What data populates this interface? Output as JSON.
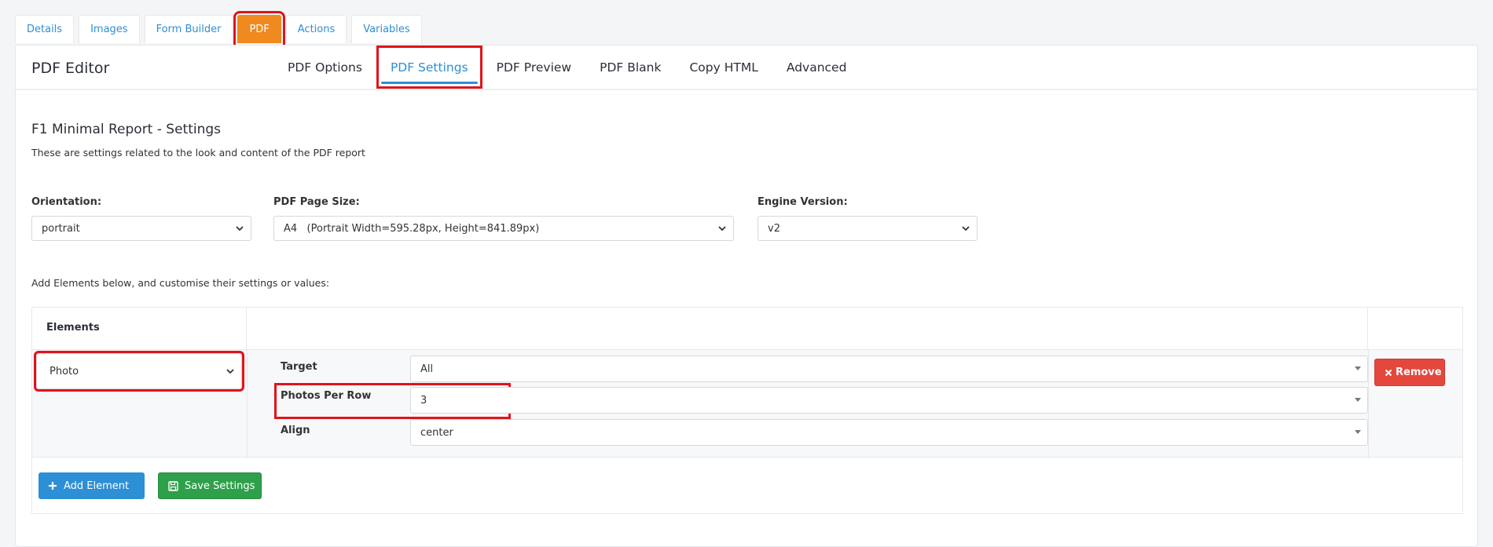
{
  "top_tabs": [
    {
      "label": "Details"
    },
    {
      "label": "Images"
    },
    {
      "label": "Form Builder"
    },
    {
      "label": "PDF"
    },
    {
      "label": "Actions"
    },
    {
      "label": "Variables"
    }
  ],
  "panel": {
    "title": "PDF Editor",
    "subtabs": [
      {
        "label": "PDF Options"
      },
      {
        "label": "PDF Settings"
      },
      {
        "label": "PDF Preview"
      },
      {
        "label": "PDF Blank"
      },
      {
        "label": "Copy HTML"
      },
      {
        "label": "Advanced"
      }
    ]
  },
  "settings": {
    "title": "F1 Minimal Report - Settings",
    "description": "These are settings related to the look and content of the PDF report",
    "orientation": {
      "label": "Orientation:",
      "value": "portrait"
    },
    "page_size": {
      "label": "PDF Page Size:",
      "value": "A4   (Portrait Width=595.28px, Height=841.89px)"
    },
    "engine": {
      "label": "Engine Version:",
      "value": "v2"
    },
    "add_note": "Add Elements below, and customise their settings or values:"
  },
  "elements_table": {
    "header": "Elements",
    "row": {
      "element": "Photo",
      "props": [
        {
          "label": "Target",
          "value": "All"
        },
        {
          "label": "Photos Per Row",
          "value": "3"
        },
        {
          "label": "Align",
          "value": "center"
        }
      ],
      "remove_label": "Remove"
    }
  },
  "buttons": {
    "add_element": "Add Element",
    "save_settings": "Save Settings"
  },
  "colors": {
    "accent_blue": "#2d8fd5",
    "pdf_tab_orange": "#f0891f",
    "remove_red": "#e4473b",
    "save_green": "#2ea04a",
    "highlight_red": "#e0141a"
  }
}
